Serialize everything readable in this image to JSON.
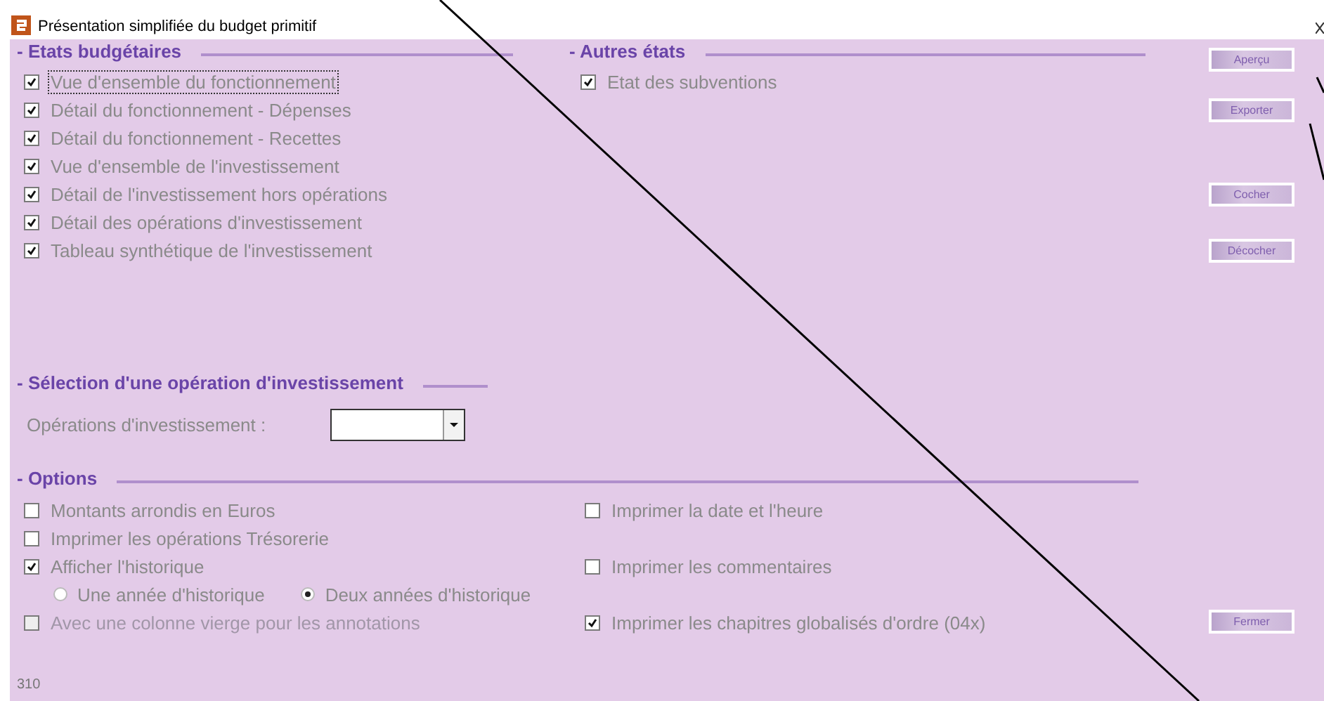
{
  "window": {
    "title": "Présentation simplifiée du budget primitif"
  },
  "budget_states": {
    "title": "- Etats budgétaires",
    "items": [
      {
        "label": "Vue d'ensemble du fonctionnement",
        "checked": true,
        "focused": true
      },
      {
        "label": "Détail du fonctionnement - Dépenses",
        "checked": true,
        "focused": false
      },
      {
        "label": "Détail du fonctionnement - Recettes",
        "checked": true,
        "focused": false
      },
      {
        "label": "Vue d'ensemble de l'investissement",
        "checked": true,
        "focused": false
      },
      {
        "label": "Détail de l'investissement hors opérations",
        "checked": true,
        "focused": false
      },
      {
        "label": "Détail des opérations d'investissement",
        "checked": true,
        "focused": false
      },
      {
        "label": "Tableau synthétique de l'investissement",
        "checked": true,
        "focused": false
      }
    ]
  },
  "other_states": {
    "title": "- Autres états",
    "items": [
      {
        "label": "Etat des subventions",
        "checked": true,
        "focused": false
      }
    ]
  },
  "operation_selection": {
    "title": "- Sélection d'une opération d'investissement",
    "field_label": "Opérations d'investissement :"
  },
  "options": {
    "title": "- Options",
    "rows": [
      {
        "cells": [
          {
            "kind": "checkbox",
            "label": "Montants arrondis en Euros",
            "checked": false,
            "disabled": false
          },
          {
            "kind": "checkbox",
            "label": "Imprimer la date et l'heure",
            "checked": false,
            "disabled": false
          }
        ]
      },
      {
        "cells": [
          {
            "kind": "checkbox",
            "label": "Imprimer les opérations Trésorerie",
            "checked": false,
            "disabled": false
          }
        ]
      },
      {
        "cells": [
          {
            "kind": "checkbox",
            "label": "Afficher l'historique",
            "checked": true,
            "disabled": false
          },
          {
            "kind": "checkbox",
            "label": "Imprimer les commentaires",
            "checked": false,
            "disabled": false
          }
        ]
      },
      {
        "cells": [
          {
            "kind": "radios",
            "options": [
              {
                "label": "Une année d'historique",
                "selected": false
              },
              {
                "label": "Deux années d'historique",
                "selected": true
              }
            ]
          }
        ]
      },
      {
        "cells": [
          {
            "kind": "checkbox",
            "label": "Avec une colonne vierge pour les annotations",
            "checked": false,
            "disabled": true
          },
          {
            "kind": "checkbox",
            "label": "Imprimer les chapitres globalisés d'ordre (04x)",
            "checked": true,
            "disabled": false
          }
        ]
      }
    ]
  },
  "buttons": [
    {
      "label": "Aperçu"
    },
    {
      "label": "Exporter"
    },
    {
      "label": "Cocher"
    },
    {
      "label": "Décocher"
    },
    {
      "label": "Fermer"
    }
  ],
  "status": "310"
}
